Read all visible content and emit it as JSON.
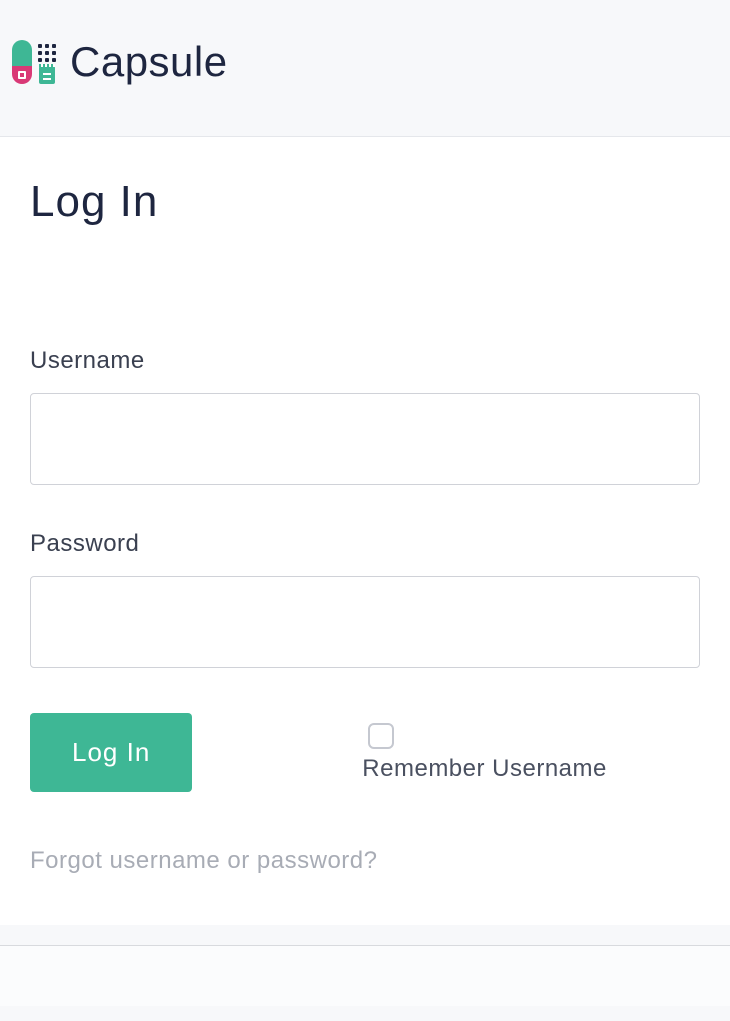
{
  "brand": {
    "name": "Capsule"
  },
  "page": {
    "title": "Log In"
  },
  "form": {
    "username_label": "Username",
    "username_value": "",
    "password_label": "Password",
    "password_value": "",
    "submit_label": "Log In",
    "remember_label": "Remember Username",
    "remember_checked": false,
    "forgot_link": "Forgot username or password?"
  },
  "colors": {
    "accent": "#3eb795",
    "secondary": "#d93976",
    "text_dark": "#1e2640"
  }
}
